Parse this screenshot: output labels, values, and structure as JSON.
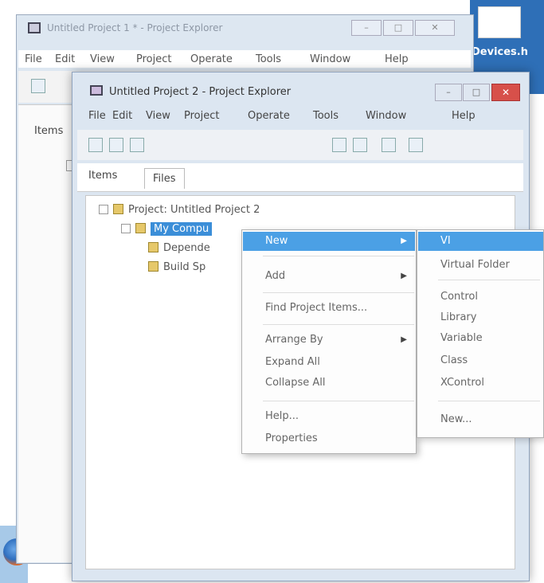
{
  "desktop": {
    "icon_label": "Devices.h"
  },
  "window1": {
    "title": "Untitled Project 1 * - Project Explorer",
    "menu": [
      "File",
      "Edit",
      "View",
      "Project",
      "Operate",
      "Tools",
      "Window",
      "Help"
    ],
    "items_tab": "Items"
  },
  "window2": {
    "title": "Untitled Project 2 - Project Explorer",
    "menu": [
      "File",
      "Edit",
      "View",
      "Project",
      "Operate",
      "Tools",
      "Window",
      "Help"
    ],
    "tabs": {
      "items": "Items",
      "files": "Files"
    },
    "tree": {
      "project": "Project: Untitled Project 2",
      "computer": "My Compu",
      "dependencies": "Depende",
      "build": "Build Sp"
    }
  },
  "context_menu": {
    "new": "New",
    "add": "Add",
    "find": "Find Project Items...",
    "arrange": "Arrange By",
    "expand": "Expand All",
    "collapse": "Collapse All",
    "help": "Help...",
    "properties": "Properties"
  },
  "submenu": {
    "vi": "VI",
    "virtual_folder": "Virtual Folder",
    "control": "Control",
    "library": "Library",
    "variable": "Variable",
    "class": "Class",
    "xcontrol": "XControl",
    "new": "New..."
  }
}
